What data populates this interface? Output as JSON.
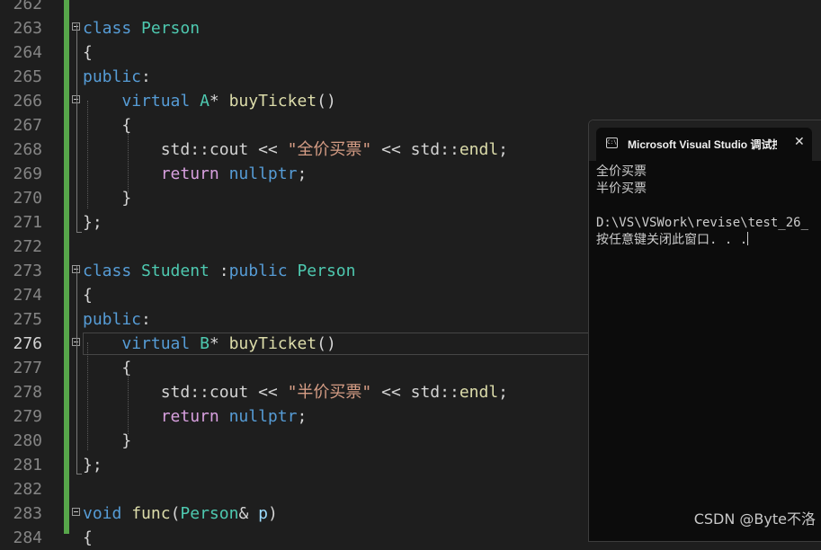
{
  "colors": {
    "background": "#1e1e1e",
    "line_number": "#858585",
    "keyword": "#569cd6",
    "type": "#4ec9b0",
    "function": "#dcdcaa",
    "string": "#d69d85",
    "text": "#d4d4d4",
    "change_bar": "#57a64a"
  },
  "editor": {
    "current_line": 276,
    "lines": [
      {
        "num": "262",
        "tokens": []
      },
      {
        "num": "263",
        "fold": true,
        "tokens": [
          {
            "t": "class",
            "c": "kw"
          },
          {
            "t": " "
          },
          {
            "t": "Person",
            "c": "type"
          }
        ]
      },
      {
        "num": "264",
        "tokens": [
          {
            "t": "{"
          }
        ]
      },
      {
        "num": "265",
        "tokens": [
          {
            "t": "public",
            "c": "kw"
          },
          {
            "t": ":"
          }
        ]
      },
      {
        "num": "266",
        "fold": true,
        "tokens": [
          {
            "t": "    "
          },
          {
            "t": "virtual",
            "c": "kw"
          },
          {
            "t": " "
          },
          {
            "t": "A",
            "c": "type"
          },
          {
            "t": "* "
          },
          {
            "t": "buyTicket",
            "c": "fn"
          },
          {
            "t": "()"
          }
        ]
      },
      {
        "num": "267",
        "tokens": [
          {
            "t": "    {"
          }
        ]
      },
      {
        "num": "268",
        "tokens": [
          {
            "t": "        std::cout << "
          },
          {
            "t": "\"全价买票\"",
            "c": "str"
          },
          {
            "t": " << std::"
          },
          {
            "t": "endl",
            "c": "fn"
          },
          {
            "t": ";"
          }
        ]
      },
      {
        "num": "269",
        "tokens": [
          {
            "t": "        "
          },
          {
            "t": "return",
            "c": "kw2"
          },
          {
            "t": " "
          },
          {
            "t": "nullptr",
            "c": "kw"
          },
          {
            "t": ";"
          }
        ]
      },
      {
        "num": "270",
        "tokens": [
          {
            "t": "    }"
          }
        ]
      },
      {
        "num": "271",
        "tokens": [
          {
            "t": "};"
          }
        ]
      },
      {
        "num": "272",
        "tokens": []
      },
      {
        "num": "273",
        "fold": true,
        "tokens": [
          {
            "t": "class",
            "c": "kw"
          },
          {
            "t": " "
          },
          {
            "t": "Student",
            "c": "type"
          },
          {
            "t": " :"
          },
          {
            "t": "public",
            "c": "kw"
          },
          {
            "t": " "
          },
          {
            "t": "Person",
            "c": "type"
          }
        ]
      },
      {
        "num": "274",
        "tokens": [
          {
            "t": "{"
          }
        ]
      },
      {
        "num": "275",
        "tokens": [
          {
            "t": "public",
            "c": "kw"
          },
          {
            "t": ":"
          }
        ]
      },
      {
        "num": "276",
        "fold": true,
        "tokens": [
          {
            "t": "    "
          },
          {
            "t": "virtual",
            "c": "kw"
          },
          {
            "t": " "
          },
          {
            "t": "B",
            "c": "type"
          },
          {
            "t": "* "
          },
          {
            "t": "buyTicket",
            "c": "fn"
          },
          {
            "t": "()"
          }
        ]
      },
      {
        "num": "277",
        "tokens": [
          {
            "t": "    {"
          }
        ]
      },
      {
        "num": "278",
        "tokens": [
          {
            "t": "        std::cout << "
          },
          {
            "t": "\"半价买票\"",
            "c": "str"
          },
          {
            "t": " << std::"
          },
          {
            "t": "endl",
            "c": "fn"
          },
          {
            "t": ";"
          }
        ]
      },
      {
        "num": "279",
        "tokens": [
          {
            "t": "        "
          },
          {
            "t": "return",
            "c": "kw2"
          },
          {
            "t": " "
          },
          {
            "t": "nullptr",
            "c": "kw"
          },
          {
            "t": ";"
          }
        ]
      },
      {
        "num": "280",
        "tokens": [
          {
            "t": "    }"
          }
        ]
      },
      {
        "num": "281",
        "tokens": [
          {
            "t": "};"
          }
        ]
      },
      {
        "num": "282",
        "tokens": []
      },
      {
        "num": "283",
        "fold": true,
        "tokens": [
          {
            "t": "void",
            "c": "kw"
          },
          {
            "t": " "
          },
          {
            "t": "func",
            "c": "fn"
          },
          {
            "t": "("
          },
          {
            "t": "Person",
            "c": "type"
          },
          {
            "t": "& "
          },
          {
            "t": "p",
            "c": "param"
          },
          {
            "t": ")"
          }
        ]
      },
      {
        "num": "284",
        "tokens": [
          {
            "t": "{"
          }
        ]
      }
    ]
  },
  "console": {
    "tab_title": "Microsoft Visual Studio 调试控",
    "tab_icon": "C:\\",
    "close_label": "✕",
    "output": [
      "全价买票",
      "半价买票",
      "",
      "D:\\VS\\VSWork\\revise\\test_26_",
      "按任意键关闭此窗口. . ."
    ]
  },
  "watermark": "CSDN @Byte不洛"
}
